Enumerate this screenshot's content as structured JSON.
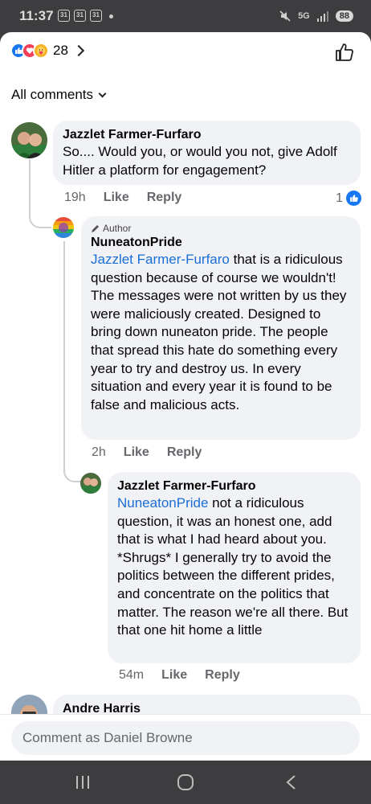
{
  "status_bar": {
    "time": "11:37",
    "icons": [
      "calendar-icon",
      "calendar-icon",
      "dot"
    ],
    "right_icons": [
      "mute-icon",
      "5g-icon",
      "signal-icon"
    ],
    "battery": "88"
  },
  "header": {
    "reaction_count": "28",
    "reaction_types": [
      "like",
      "love",
      "care"
    ]
  },
  "filter": {
    "label": "All comments"
  },
  "comments": [
    {
      "name": "Jazzlet Farmer-Furfaro",
      "text": "So.... Would you, or would you not, give Adolf Hitler a platform for engagement?",
      "time": "19h",
      "like_label": "Like",
      "reply_label": "Reply",
      "like_count": "1"
    },
    {
      "author_badge": "Author",
      "name": "NuneatonPride",
      "mention": "Jazzlet Farmer-Furfaro",
      "text": " that is a ridiculous question because of course we wouldn't! The messages were not written by us they were maliciously created. Designed to bring down nuneaton pride. The people that spread this hate do something every year to try and destroy us. In every situation and every year it is found to be false and malicious acts.",
      "time": "2h",
      "like_label": "Like",
      "reply_label": "Reply"
    },
    {
      "name": "Jazzlet Farmer-Furfaro",
      "mention": "NuneatonPride",
      "text": " not a ridiculous question, it was an honest one, add that is what I had heard about you. *Shrugs* I generally try to avoid the politics between the different prides, and concentrate on the politics that matter. The reason we're all there. But that one hit home a little",
      "time": "54m",
      "like_label": "Like",
      "reply_label": "Reply"
    },
    {
      "name": "Andre Harris"
    }
  ],
  "composer": {
    "placeholder": "Comment as Daniel Browne"
  },
  "colors": {
    "mention": "#1a6ed8",
    "like_blue": "#1877f2",
    "bubble": "#f0f2f5",
    "meta_text": "#65676b"
  }
}
